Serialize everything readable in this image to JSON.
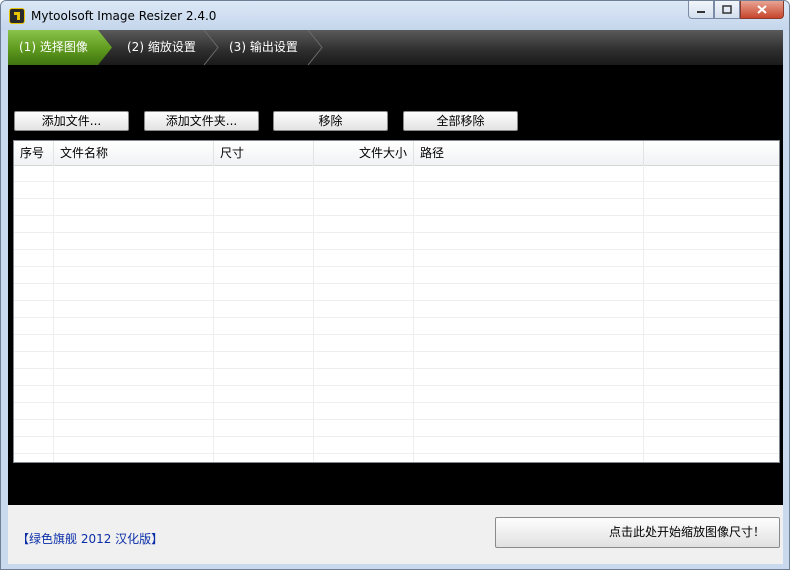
{
  "window": {
    "title": "Mytoolsoft Image Resizer 2.4.0"
  },
  "wizard": {
    "steps": [
      {
        "label": "(1) 选择图像"
      },
      {
        "label": "(2) 缩放设置"
      },
      {
        "label": "(3) 输出设置"
      }
    ]
  },
  "toolbar": {
    "add_files": "添加文件...",
    "add_folder": "添加文件夹...",
    "remove": "移除",
    "remove_all": "全部移除"
  },
  "file_list": {
    "columns": [
      "序号",
      "文件名称",
      "尺寸",
      "文件大小",
      "路径"
    ],
    "rows": []
  },
  "footer": {
    "version_note": "【绿色旗舰 2012 汉化版】",
    "start_button": "点击此处开始缩放图像尺寸！"
  },
  "colors": {
    "active_step": "#5e9a1e",
    "version_text": "#0a2ea8"
  }
}
